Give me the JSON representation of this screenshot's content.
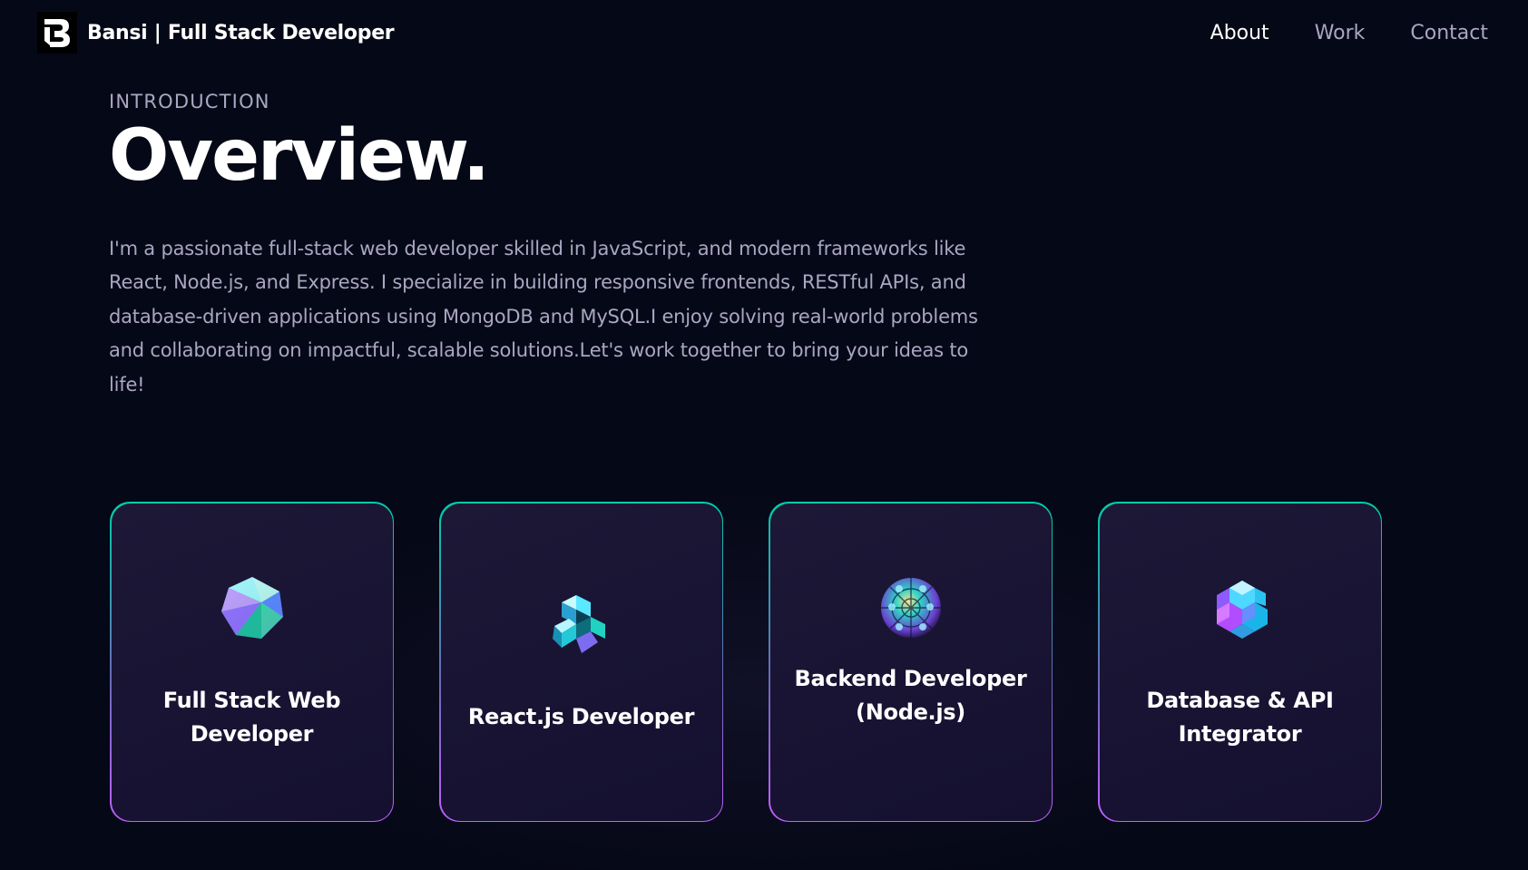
{
  "navbar": {
    "brand": "Bansi  | Full Stack Developer",
    "logo_icon": "b-monogram-icon",
    "links": [
      "About",
      "Work",
      "Contact"
    ],
    "active_link": "About"
  },
  "section": {
    "subtitle": "Introduction",
    "title": "Overview.",
    "intro": "I'm a passionate full-stack web developer skilled in JavaScript, and modern frameworks like React, Node.js, and Express. I specialize in building responsive frontends, RESTful APIs, and database-driven applications using MongoDB and MySQL.I enjoy solving real-world problems and collaborating on impactful, scalable solutions.Let's work together to bring your ideas to life!"
  },
  "cards": [
    {
      "title": "Full Stack Web Developer",
      "icon": "crystal-icosahedron-icon"
    },
    {
      "title": "React.js Developer",
      "icon": "crystal-cube-cluster-icon"
    },
    {
      "title": "Backend Developer (Node.js)",
      "icon": "crystal-sphere-icon"
    },
    {
      "title": "Database & API Integrator",
      "icon": "crystal-hexagon-cluster-icon"
    }
  ],
  "colors": {
    "background": "#050816",
    "secondary_text": "#aaa6c3",
    "card_bg": "#151030",
    "border_top": "#00cea8",
    "border_bottom": "#bf61ff"
  }
}
